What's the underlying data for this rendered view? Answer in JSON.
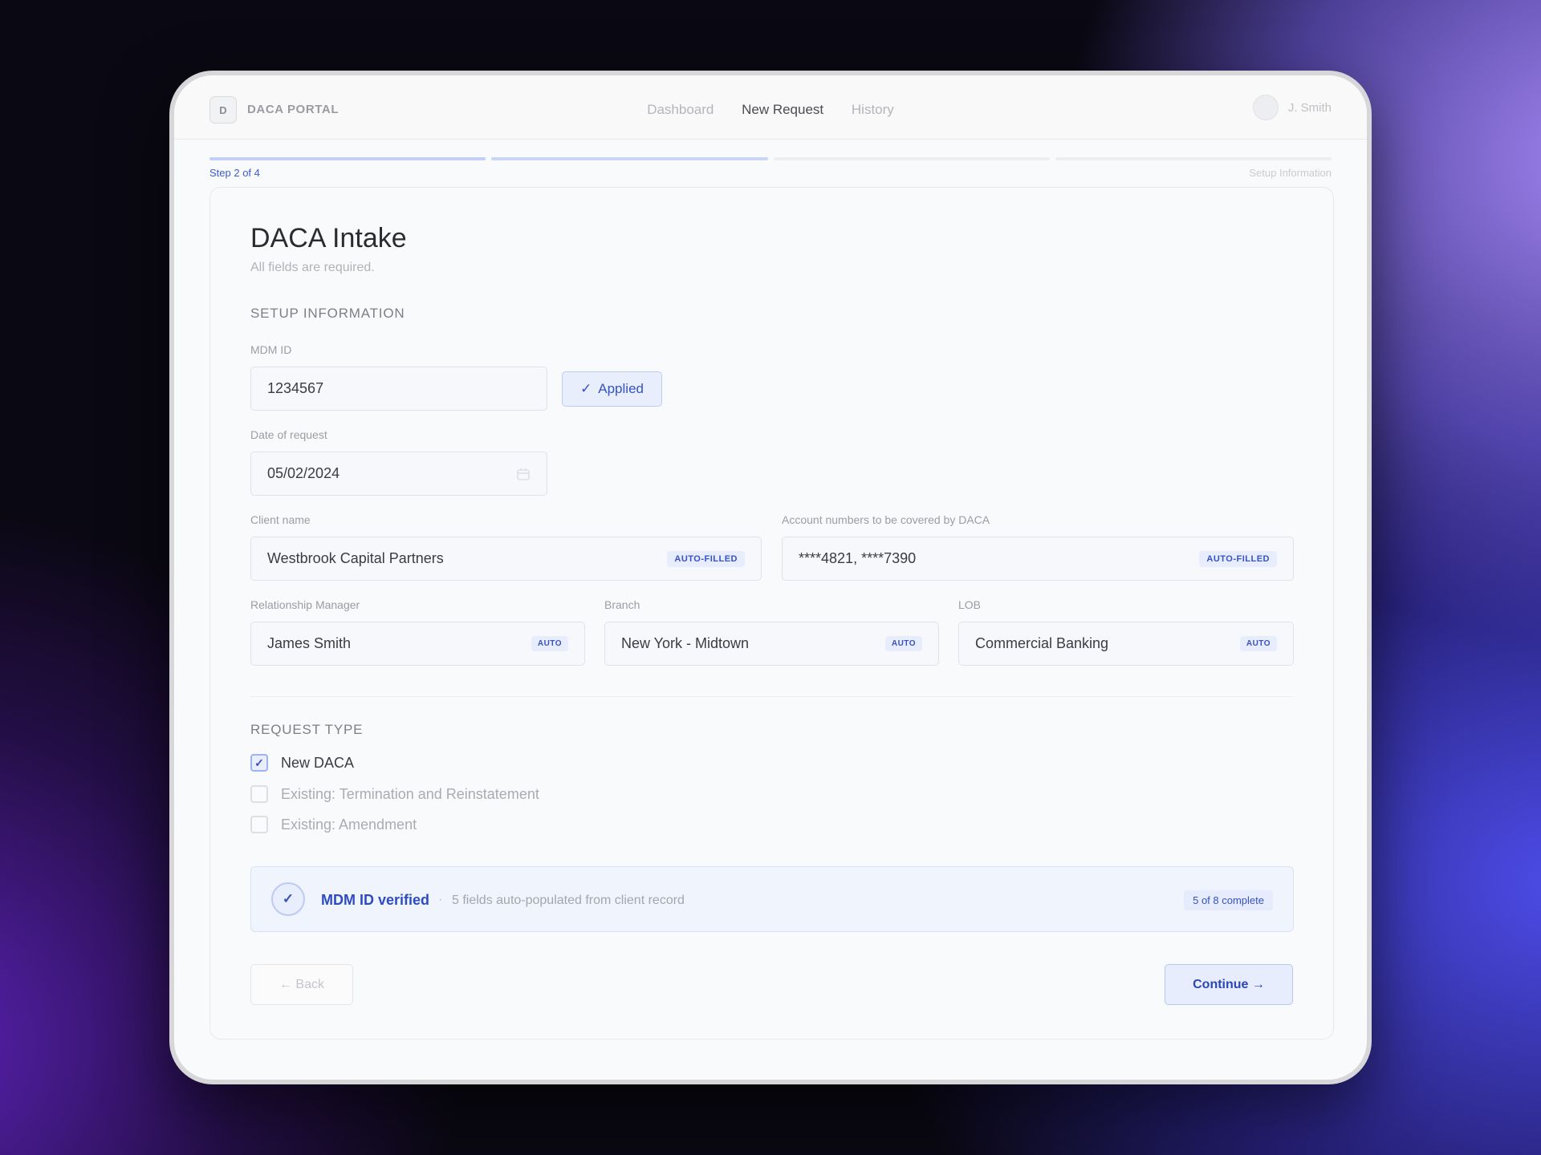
{
  "header": {
    "logo_letter": "D",
    "brand": "DACA PORTAL",
    "nav": [
      "Dashboard",
      "New Request",
      "History"
    ],
    "user_name": "J. Smith"
  },
  "progress": {
    "step_label": "Step 2 of 4",
    "current_section": "Setup Information",
    "total_steps": 4,
    "current_step": 2
  },
  "form": {
    "title": "DACA Intake",
    "subtitle": "All fields are required.",
    "setup_heading": "SETUP INFORMATION",
    "mdm_id": {
      "label": "MDM ID",
      "value": "1234567",
      "applied_label": "Applied"
    },
    "date": {
      "label": "Date of request",
      "value": "05/02/2024"
    },
    "client_name": {
      "label": "Client name",
      "value": "Westbrook Capital Partners",
      "badge": "AUTO-FILLED"
    },
    "accounts": {
      "label": "Account numbers to be covered by DACA",
      "value": "****4821, ****7390",
      "badge": "AUTO-FILLED"
    },
    "rm": {
      "label": "Relationship Manager",
      "value": "James Smith",
      "badge": "AUTO"
    },
    "branch": {
      "label": "Branch",
      "value": "New York - Midtown",
      "badge": "AUTO"
    },
    "lob": {
      "label": "LOB",
      "value": "Commercial Banking",
      "badge": "AUTO"
    },
    "request_heading": "REQUEST TYPE",
    "request_options": [
      {
        "label": "New DACA",
        "checked": true
      },
      {
        "label": "Existing: Termination and Reinstatement",
        "checked": false
      },
      {
        "label": "Existing: Amendment",
        "checked": false
      }
    ]
  },
  "verification": {
    "title": "MDM ID verified",
    "separator": "·",
    "description": "5 fields auto-populated from client record",
    "count": "5 of 8 complete"
  },
  "actions": {
    "back": "← Back",
    "continue": "Continue →"
  }
}
